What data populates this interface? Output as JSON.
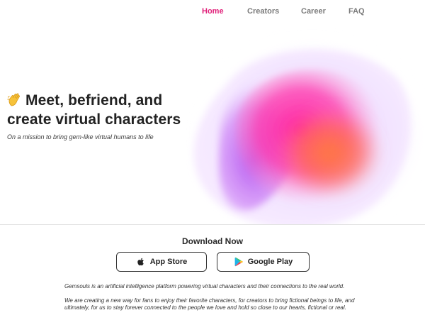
{
  "nav": {
    "items": [
      {
        "label": "Home",
        "active": true
      },
      {
        "label": "Creators",
        "active": false
      },
      {
        "label": "Career",
        "active": false
      },
      {
        "label": "FAQ",
        "active": false
      }
    ]
  },
  "hero": {
    "emoji_icon": "waving-hand-icon",
    "title_line1": "Meet, befriend, and",
    "title_line2": "create virtual characters",
    "subtitle": "On a mission to bring gem-like virtual humans to life"
  },
  "download": {
    "title": "Download Now",
    "buttons": [
      {
        "label": "App Store",
        "icon": "apple-icon"
      },
      {
        "label": "Google Play",
        "icon": "google-play-icon"
      }
    ]
  },
  "about": {
    "paragraph1": "Gemsouls is an artificial intelligence platform powering virtual characters and their connections to the real world.",
    "paragraph2": "We are creating a new way for fans to enjoy their favorite characters, for creators to bring fictional beings to life, and ultimately, for us to stay forever connected to the people we love and hold so close to our hearts, fictional or real."
  },
  "colors": {
    "accent": "#e0217a",
    "nav_inactive": "#7a7a7a",
    "blob_pink": "#ff2fa8",
    "blob_orange": "#ff7a3d",
    "blob_purple": "#b04ff0"
  }
}
